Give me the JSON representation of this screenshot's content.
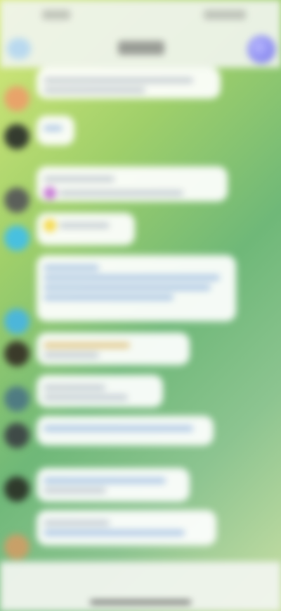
{
  "status_bar": {},
  "header": {},
  "messages": [
    {
      "avatar_color": "#e8a36a"
    },
    {
      "avatar_color": "#343b2f"
    },
    {
      "avatar_color": "#5b5f5a"
    },
    {
      "avatar_color": "#48c0e0"
    },
    {
      "avatar_color": "#4cb6da"
    },
    {
      "avatar_color": "#3a3a2a"
    },
    {
      "avatar_color": "#4f7b82"
    },
    {
      "avatar_color": "#3f4a47"
    },
    {
      "avatar_color": "#2f3a2c"
    },
    {
      "avatar_color": "#c8a068"
    }
  ],
  "input_bar": {}
}
